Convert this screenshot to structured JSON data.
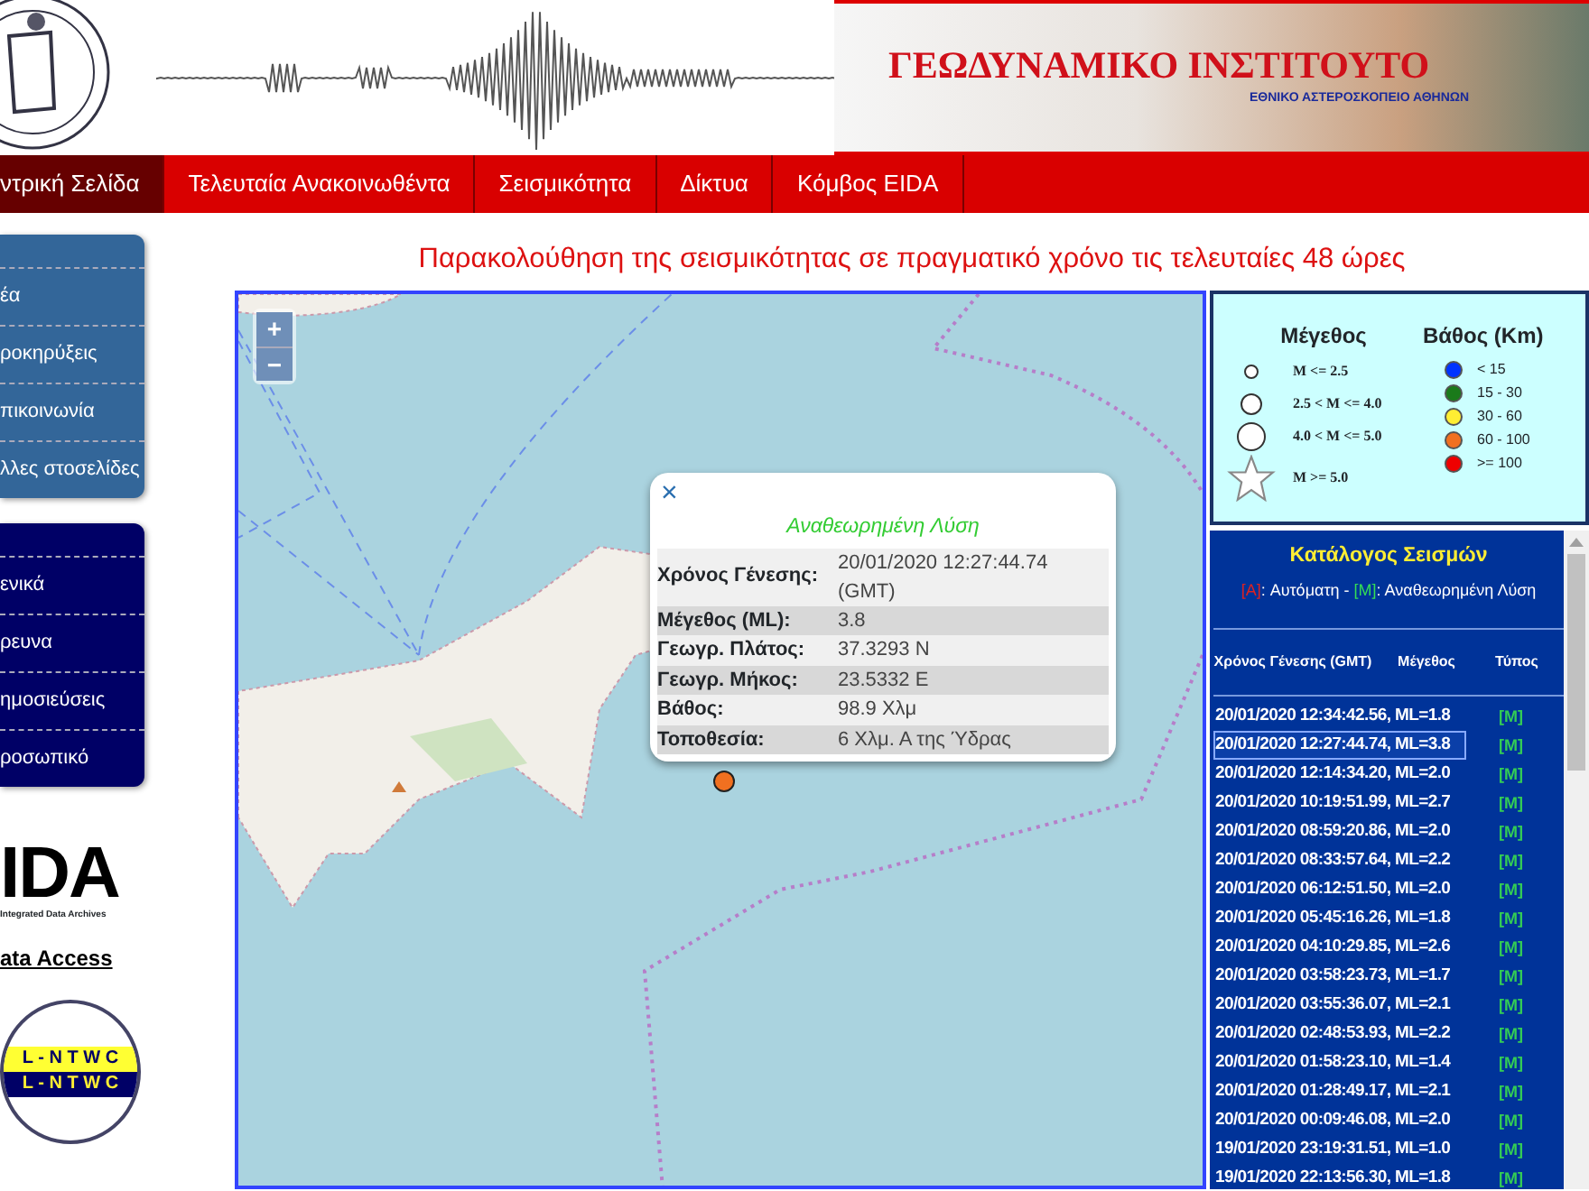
{
  "header": {
    "title": "ΓΕΩΔΥΝΑΜΙΚΟ ΙΝΣΤΙΤΟΥΤΟ",
    "subtitle": "ΕΘΝΙΚΟ ΑΣΤΕΡΟΣΚΟΠΕΙΟ ΑΘΗΝΩΝ"
  },
  "nav": [
    {
      "label": "ντρική Σελίδα",
      "selected": true
    },
    {
      "label": "Τελευταία Ανακοινωθέντα",
      "selected": false
    },
    {
      "label": "Σεισμικότητα",
      "selected": false
    },
    {
      "label": "Δίκτυα",
      "selected": false
    },
    {
      "label": "Κόμβος EIDA",
      "selected": false
    }
  ],
  "sidebar": {
    "menus": [
      {
        "items": [
          "έα",
          "ροκηρύξεις",
          "πικοινωνία",
          "λλες στοσελίδες"
        ]
      },
      {
        "items": [
          "ενικά",
          "ρευνα",
          "ημοσιεύσεις",
          "ροσωπικό"
        ]
      }
    ],
    "eida_logo": {
      "mark": "IDA",
      "caption": "Integrated Data Archives"
    },
    "eida_link": "ata Access",
    "ntwc_logo": [
      "L - N T W C",
      "L - N T W C"
    ]
  },
  "page_title": "Παρακολούθηση της σεισμικότητας σε πραγματικό χρόνο τις τελευταίες 48 ώρες",
  "map": {
    "zoom_in": "+",
    "zoom_out": "−",
    "popup": {
      "close": "×",
      "title": "Αναθεωρημένη Λύση",
      "rows": [
        {
          "label": "Χρόνος Γένεσης:",
          "value": "20/01/2020 12:27:44.74 (GMT)"
        },
        {
          "label": "Μέγεθος (ML):",
          "value": "3.8"
        },
        {
          "label": "Γεωγρ. Πλάτος:",
          "value": "37.3293 N"
        },
        {
          "label": "Γεωγρ. Μήκος:",
          "value": "23.5332 E"
        },
        {
          "label": "Βάθος:",
          "value": "98.9 Χλμ"
        },
        {
          "label": "Τοποθεσία:",
          "value": "6 Χλμ. Α της Ύδρας"
        }
      ]
    },
    "event_marker": {
      "color": "#f07020"
    }
  },
  "legend": {
    "magnitude_title": "Μέγεθος",
    "magnitudes": [
      {
        "kind": "small",
        "label": "M <= 2.5"
      },
      {
        "kind": "medium",
        "label": "2.5 < M <= 4.0"
      },
      {
        "kind": "large",
        "label": "4.0 < M <= 5.0"
      },
      {
        "kind": "star",
        "label": "M >= 5.0"
      }
    ],
    "depth_title": "Βάθος (Km)",
    "depths": [
      {
        "label": "< 15",
        "color": "#0033ff"
      },
      {
        "label": "15 - 30",
        "color": "#1a7a1a"
      },
      {
        "label": "30 - 60",
        "color": "#ffee33"
      },
      {
        "label": "60 - 100",
        "color": "#f07020"
      },
      {
        "label": ">= 100",
        "color": "#ee0000"
      }
    ]
  },
  "catalog": {
    "title": "Κατάλογος Σεισμών",
    "note": [
      {
        "text": "[A]",
        "kind": "auto"
      },
      {
        "text": ": Αυτόματη - ",
        "kind": "plain"
      },
      {
        "text": "[M]",
        "kind": "manual"
      },
      {
        "text": ": Αναθεωρημένη Λύση",
        "kind": "plain"
      }
    ],
    "columns": [
      "Χρόνος Γένεσης (GMT)",
      "Μέγεθος",
      "Τύπος"
    ],
    "rows": [
      {
        "event": "20/01/2020 12:34:42.56, ML=1.8",
        "type": "[M]",
        "selected": false
      },
      {
        "event": "20/01/2020 12:27:44.74, ML=3.8",
        "type": "[M]",
        "selected": true
      },
      {
        "event": "20/01/2020 12:14:34.20, ML=2.0",
        "type": "[M]",
        "selected": false
      },
      {
        "event": "20/01/2020 10:19:51.99, ML=2.7",
        "type": "[M]",
        "selected": false
      },
      {
        "event": "20/01/2020 08:59:20.86, ML=2.0",
        "type": "[M]",
        "selected": false
      },
      {
        "event": "20/01/2020 08:33:57.64, ML=2.2",
        "type": "[M]",
        "selected": false
      },
      {
        "event": "20/01/2020 06:12:51.50, ML=2.0",
        "type": "[M]",
        "selected": false
      },
      {
        "event": "20/01/2020 05:45:16.26, ML=1.8",
        "type": "[M]",
        "selected": false
      },
      {
        "event": "20/01/2020 04:10:29.85, ML=2.6",
        "type": "[M]",
        "selected": false
      },
      {
        "event": "20/01/2020 03:58:23.73, ML=1.7",
        "type": "[M]",
        "selected": false
      },
      {
        "event": "20/01/2020 03:55:36.07, ML=2.1",
        "type": "[M]",
        "selected": false
      },
      {
        "event": "20/01/2020 02:48:53.93, ML=2.2",
        "type": "[M]",
        "selected": false
      },
      {
        "event": "20/01/2020 01:58:23.10, ML=1.4",
        "type": "[M]",
        "selected": false
      },
      {
        "event": "20/01/2020 01:28:49.17, ML=2.1",
        "type": "[M]",
        "selected": false
      },
      {
        "event": "20/01/2020 00:09:46.08, ML=2.0",
        "type": "[M]",
        "selected": false
      },
      {
        "event": "19/01/2020 23:19:31.51, ML=1.0",
        "type": "[M]",
        "selected": false
      },
      {
        "event": "19/01/2020 22:13:56.30, ML=1.8",
        "type": "[M]",
        "selected": false
      }
    ]
  }
}
